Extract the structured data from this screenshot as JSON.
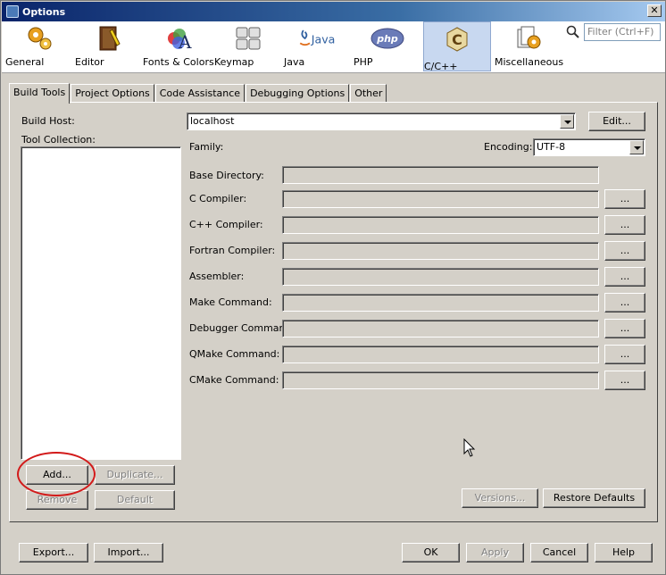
{
  "window": {
    "title": "Options"
  },
  "categories": [
    {
      "label": "General",
      "icon": "gear-icon"
    },
    {
      "label": "Editor",
      "icon": "book-pencil-icon"
    },
    {
      "label": "Fonts & Colors",
      "icon": "fonts-colors-icon"
    },
    {
      "label": "Keymap",
      "icon": "keyboard-icon"
    },
    {
      "label": "Java",
      "icon": "java-icon"
    },
    {
      "label": "PHP",
      "icon": "php-icon"
    },
    {
      "label": "C/C++",
      "icon": "cpp-icon"
    },
    {
      "label": "Miscellaneous",
      "icon": "misc-icon"
    }
  ],
  "selected_category": "C/C++",
  "filter": {
    "placeholder": "Filter (Ctrl+F)"
  },
  "tabs": [
    "Build Tools",
    "Project Options",
    "Code Assistance",
    "Debugging Options",
    "Other"
  ],
  "active_tab": "Build Tools",
  "build_host": {
    "label": "Build Host:",
    "value": "localhost",
    "edit_label": "Edit..."
  },
  "tool_collection": {
    "label": "Tool Collection:"
  },
  "family": {
    "label": "Family:"
  },
  "encoding": {
    "label": "Encoding:",
    "value": "UTF-8"
  },
  "fields": [
    {
      "label": "Base Directory:",
      "has_browse": false
    },
    {
      "label": "C Compiler:",
      "has_browse": true
    },
    {
      "label": "C++ Compiler:",
      "has_browse": true
    },
    {
      "label": "Fortran Compiler:",
      "has_browse": true
    },
    {
      "label": "Assembler:",
      "has_browse": true
    },
    {
      "label": "Make Command:",
      "has_browse": true
    },
    {
      "label": "Debugger Command:",
      "has_browse": true
    },
    {
      "label": "QMake Command:",
      "has_browse": true
    },
    {
      "label": "CMake Command:",
      "has_browse": true
    }
  ],
  "browse_label": "...",
  "collection_buttons": {
    "add": "Add...",
    "duplicate": "Duplicate...",
    "remove": "Remove",
    "default": "Default"
  },
  "panel_buttons": {
    "versions": "Versions...",
    "restore": "Restore Defaults"
  },
  "footer": {
    "export": "Export...",
    "import": "Import...",
    "ok": "OK",
    "apply": "Apply",
    "cancel": "Cancel",
    "help": "Help"
  },
  "colors": {
    "title_start": "#0a246a",
    "selected_tab_bg": "#c8d8f0",
    "annotation": "#d21a1a"
  }
}
